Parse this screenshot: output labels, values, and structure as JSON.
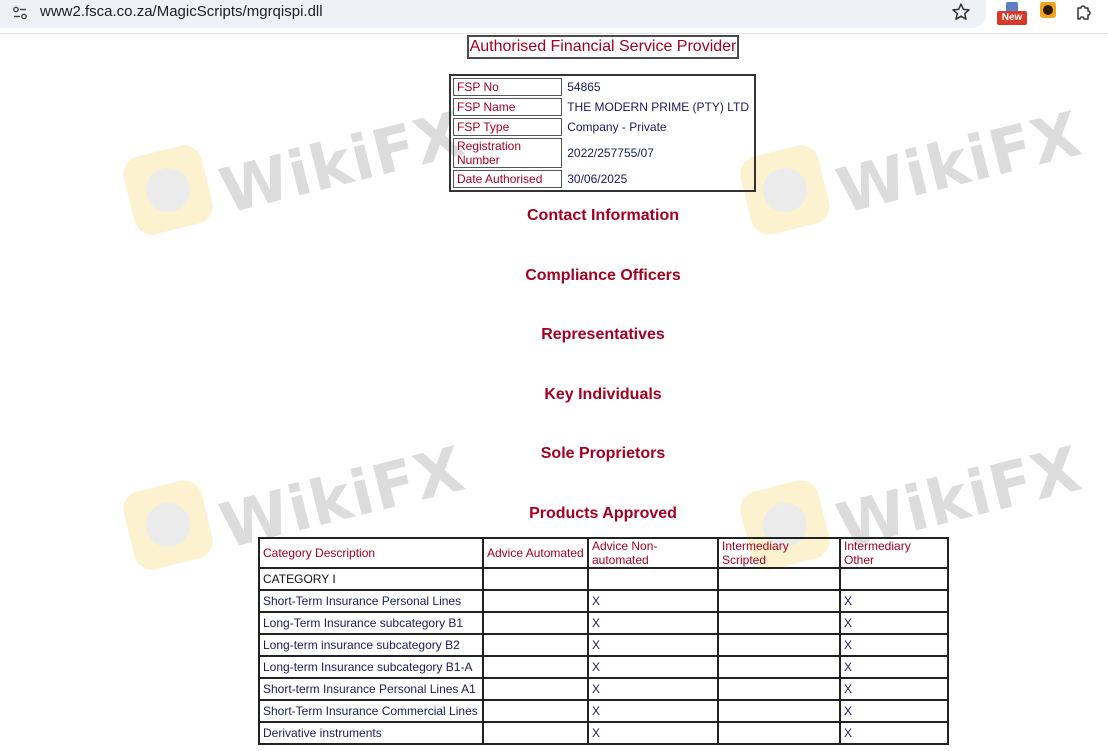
{
  "browser": {
    "url": "www2.fsca.co.za/MagicScripts/mgrqispi.dll",
    "extension_badge": "New"
  },
  "watermark": {
    "text": "WikiFX"
  },
  "page": {
    "title": "Authorised Financial Service Provider"
  },
  "fsp_details": [
    {
      "label": "FSP No",
      "value": "54865"
    },
    {
      "label": "FSP Name",
      "value": "THE MODERN PRIME (PTY) LTD"
    },
    {
      "label": "FSP Type",
      "value": "Company - Private"
    },
    {
      "label": "Registration Number",
      "value": "2022/257755/07"
    },
    {
      "label": "Date Authorised",
      "value": "30/06/2025"
    }
  ],
  "sections": {
    "contact": "Contact Information",
    "compliance": "Compliance Officers",
    "representatives": "Representatives",
    "key_individuals": "Key Individuals",
    "sole_proprietors": "Sole Proprietors",
    "products": "Products Approved"
  },
  "products": {
    "headers": [
      "Category Description",
      "Advice Automated",
      "Advice Non-automated",
      "Intermediary Scripted",
      "Intermediary Other"
    ],
    "rows": [
      [
        "CATEGORY I",
        "",
        "",
        "",
        ""
      ],
      [
        "Short-Term Insurance Personal Lines",
        "",
        "X",
        "",
        "X"
      ],
      [
        "Long-Term Insurance subcategory B1",
        "",
        "X",
        "",
        "X"
      ],
      [
        "Long-term insurance subcategory B2",
        "",
        "X",
        "",
        "X"
      ],
      [
        "Long-term Insurance subcategory B1-A",
        "",
        "X",
        "",
        "X"
      ],
      [
        "Short-term Insurance Personal Lines A1",
        "",
        "X",
        "",
        "X"
      ],
      [
        "Short-Term Insurance Commercial Lines",
        "",
        "X",
        "",
        "X"
      ],
      [
        "Derivative instruments",
        "",
        "X",
        "",
        "X"
      ]
    ]
  },
  "colors": {
    "heading": "#a50021",
    "value_text": "#1a1a5e",
    "watermark_logo": "#fcf2cf",
    "watermark_text": "#dcdcdc"
  }
}
